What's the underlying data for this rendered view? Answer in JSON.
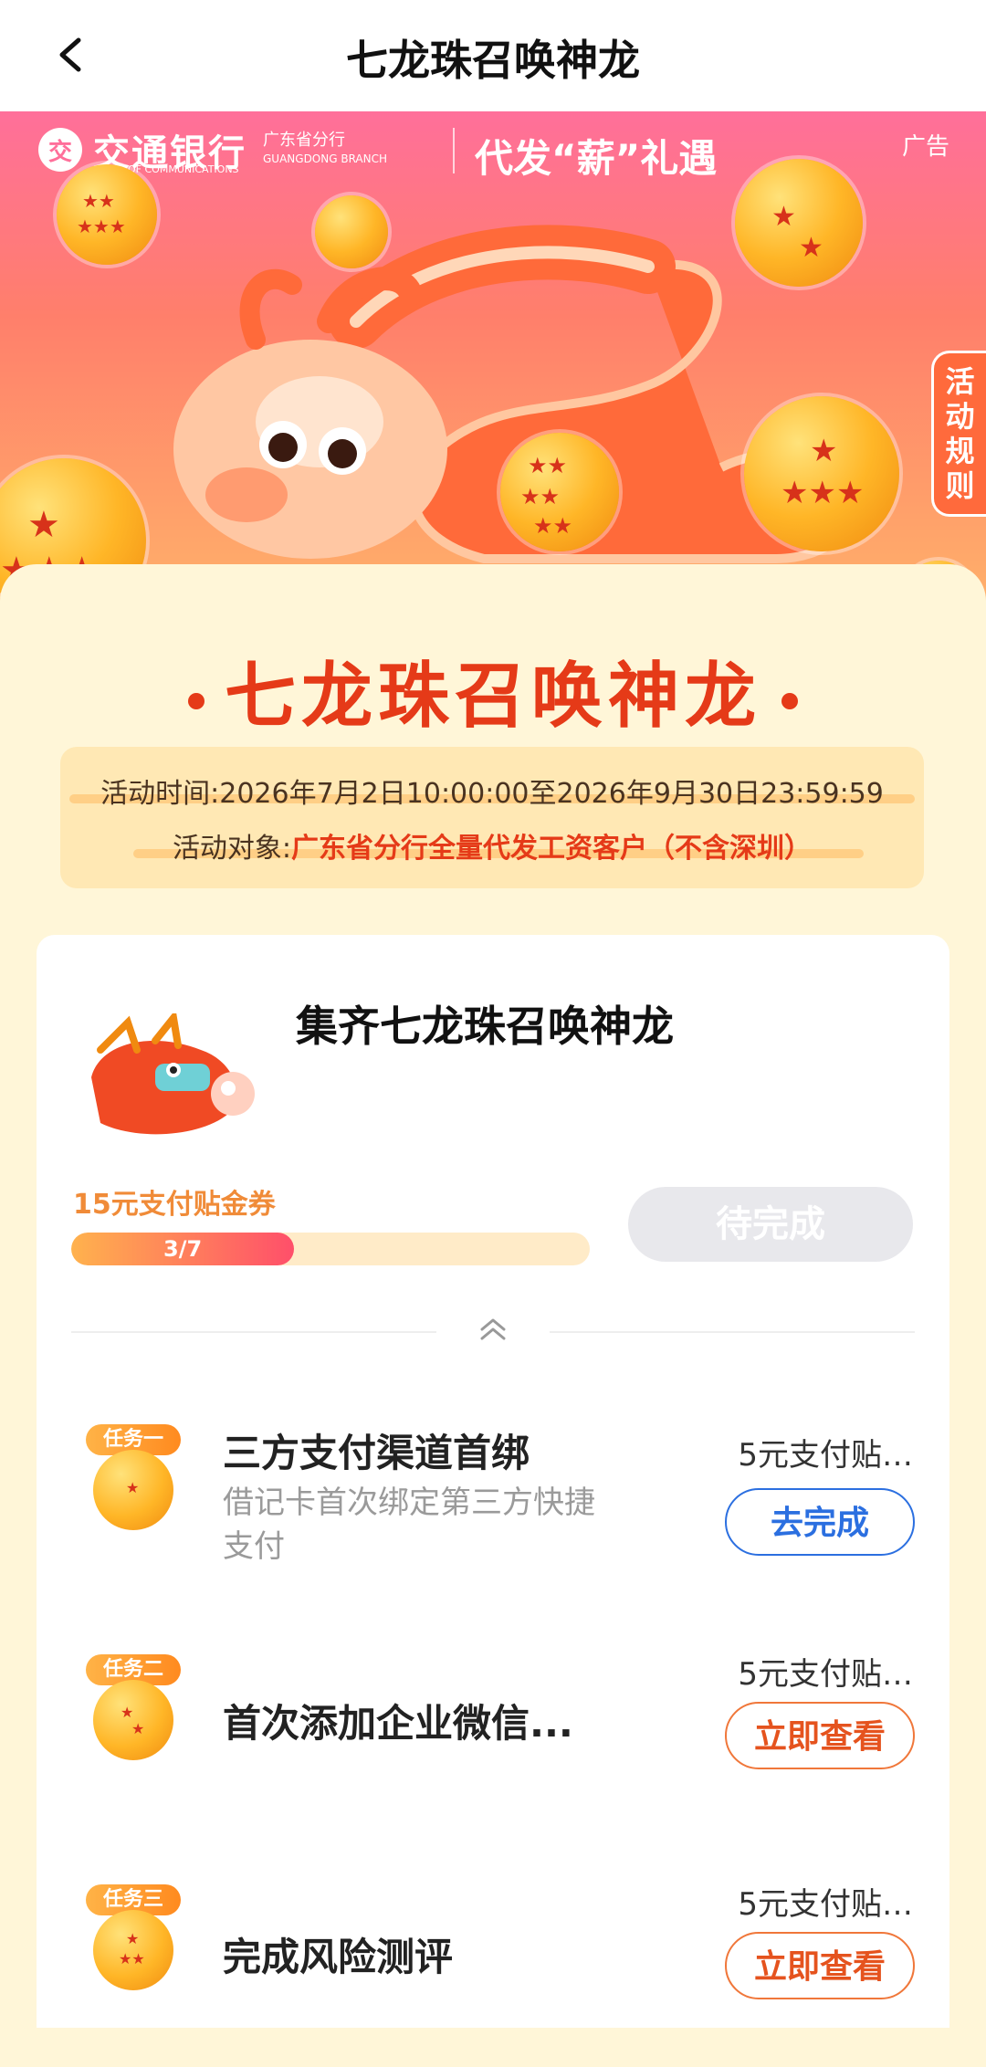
{
  "header": {
    "title": "七龙珠召唤神龙"
  },
  "banner": {
    "bank_logo_text": "交",
    "bank_name": "交通银行",
    "bank_name_en_line1": "BANK OF",
    "bank_name_en_line2": "COMMUNICATIONS",
    "branch_cn": "广东省分行",
    "branch_en": "GUANGDONG BRANCH",
    "slogan": "代发“薪”礼遇",
    "ad_label": "广告",
    "rules_label": "活动规则"
  },
  "activity": {
    "title": "七龙珠召唤神龙",
    "time_label": "活动时间:",
    "time_value": "2026年7月2日10:00:00至2026年9月30日23:59:59",
    "target_label": "活动对象:",
    "target_value": "广东省分行全量代发工资客户（不含深圳）"
  },
  "card": {
    "title": "集齐七龙珠召唤神龙",
    "reward_label": "15元支付贴金券",
    "progress_text": "3/7",
    "progress_fraction": 0.43,
    "status_button": "待完成"
  },
  "tasks": [
    {
      "badge": "任务一",
      "name": "三方支付渠道首绑",
      "desc": "借记卡首次绑定第三方快捷支付",
      "reward": "5元支付贴…",
      "button": "去完成",
      "button_style": "blue",
      "stars": 1
    },
    {
      "badge": "任务二",
      "name": "首次添加企业微信...",
      "desc": "",
      "reward": "5元支付贴…",
      "button": "立即查看",
      "button_style": "orange",
      "stars": 2
    },
    {
      "badge": "任务三",
      "name": "完成风险测评",
      "desc": "",
      "reward": "5元支付贴…",
      "button": "立即查看",
      "button_style": "orange",
      "stars": 3
    }
  ],
  "colors": {
    "accent_red": "#e53a18",
    "blue_button": "#2b6fe0",
    "orange_button": "#f0773a",
    "banner_pink": "#ff6f9a"
  }
}
